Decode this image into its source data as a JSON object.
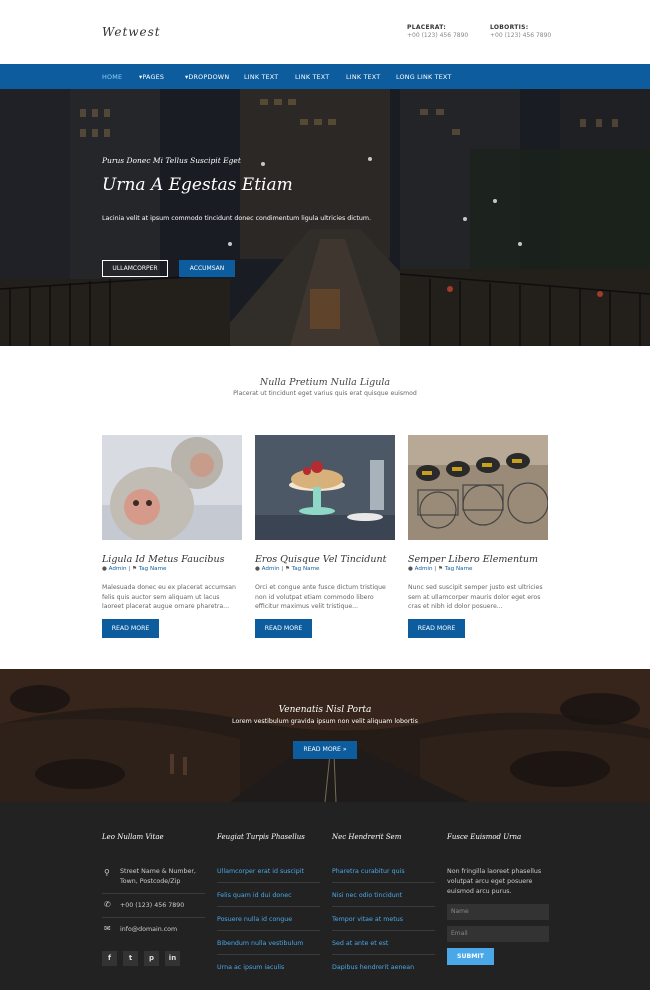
{
  "header": {
    "logo": "Wetwest",
    "contacts": [
      {
        "label": "PLACERAT:",
        "value": "+00 (123) 456 7890"
      },
      {
        "label": "LOBORTIS:",
        "value": "+00 (123) 456 7890"
      }
    ]
  },
  "nav": {
    "items": [
      "HOME",
      "▾PAGES",
      "▾DROPDOWN",
      "LINK TEXT",
      "LINK TEXT",
      "LINK TEXT",
      "LONG LINK TEXT"
    ]
  },
  "hero": {
    "subtitle": "Purus Donec Mi Tellus Suscipit Eget",
    "title": "Urna A Egestas Etiam",
    "text": "Lacinia velit at ipsum commodo tincidunt donec condimentum ligula ultricies dictum.",
    "buttons": [
      "ULLAMCORPER",
      "ACCUMSAN"
    ]
  },
  "features": {
    "title": "Nulla Pretium Nulla Ligula",
    "subtitle": "Placerat ut tincidunt eget varius quis erat quisque euismod",
    "cards": [
      {
        "title": "Ligula Id Metus Faucibus",
        "author": "Admin",
        "tag": "Tag Name",
        "text": "Malesuada donec eu ex placerat accumsan felis quis auctor sem aliquam ut lacus laoreet placerat augue ornare pharetra...",
        "button": "READ MORE"
      },
      {
        "title": "Eros Quisque Vel Tincidunt",
        "author": "Admin",
        "tag": "Tag Name",
        "text": "Orci et congue ante fusce dictum tristique non id volutpat etiam commodo libero efficitur maximus velit tristique...",
        "button": "READ MORE"
      },
      {
        "title": "Semper Libero Elementum",
        "author": "Admin",
        "tag": "Tag Name",
        "text": "Nunc sed suscipit semper justo est ultricies sem at ullamcorper mauris dolor eget eros cras et nibh id dolor posuere...",
        "button": "READ MORE"
      }
    ]
  },
  "banner": {
    "title": "Venenatis Nisl Porta",
    "text": "Lorem vestibulum gravida ipsum non velit aliquam lobortis",
    "button": "READ MORE »"
  },
  "footer": {
    "col1": {
      "title": "Leo Nullam Vitae",
      "address_line1": "Street Name & Number,",
      "address_line2": "Town, Postcode/Zip",
      "phone": "+00 (123) 456 7890",
      "email": "info@domain.com",
      "social": [
        "f",
        "t",
        "p",
        "in"
      ]
    },
    "col2": {
      "title": "Feugiat Turpis Phasellus",
      "links": [
        "Ullamcorper erat id suscipit",
        "Felis quam id dui donec",
        "Posuere nulla id congue",
        "Bibendum nulla vestibulum",
        "Urna ac ipsum iaculis"
      ]
    },
    "col3": {
      "title": "Nec Hendrerit Sem",
      "links": [
        "Pharetra curabitur quis",
        "Nisi nec odio tincidunt",
        "Tempor vitae at metus",
        "Sed at ante et est",
        "Dapibus hendrerit aenean"
      ]
    },
    "col4": {
      "title": "Fusce Euismod Urna",
      "text_line1": "Non fringilla laoreet phasellus",
      "text_line2": "volutpat arcu eget posuere",
      "text_line3": "euismod arcu purus.",
      "name_placeholder": "Name",
      "email_placeholder": "Email",
      "button": "SUBMIT"
    }
  },
  "colors": {
    "primary": "#0d5d9e",
    "footer_bg": "#222222",
    "link": "#4aa8e8"
  }
}
